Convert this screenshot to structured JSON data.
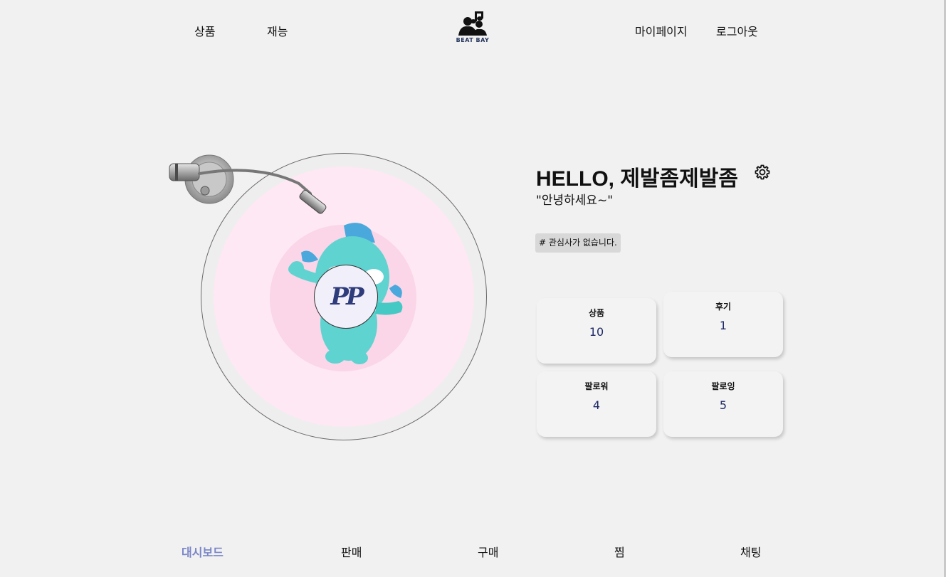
{
  "header": {
    "nav_left": [
      {
        "label": "상품"
      },
      {
        "label": "재능"
      }
    ],
    "logo_text": "BEAT BAY",
    "nav_right": [
      {
        "label": "마이페이지"
      },
      {
        "label": "로그아웃"
      }
    ]
  },
  "record": {
    "label_text": "PP"
  },
  "profile": {
    "greeting": "HELLO, 제발좀제발좀",
    "bio": "\"안녕하세요~\"",
    "interest_tag": "# 관심사가 없습니다.",
    "stats": [
      {
        "label": "상품",
        "value": "10"
      },
      {
        "label": "후기",
        "value": "1"
      },
      {
        "label": "팔로워",
        "value": "4"
      },
      {
        "label": "팔로잉",
        "value": "5"
      }
    ]
  },
  "tabs": [
    {
      "label": "대시보드",
      "active": true
    },
    {
      "label": "판매",
      "active": false
    },
    {
      "label": "구매",
      "active": false
    },
    {
      "label": "찜",
      "active": false
    },
    {
      "label": "채팅",
      "active": false
    }
  ],
  "colors": {
    "background": "#f1f1f1",
    "active_tab": "#7a86c8",
    "stat_value": "#1f2a66",
    "record_pink": "#fde8f3",
    "character": "#5fd3d0"
  },
  "icons": {
    "settings": "gear-icon",
    "logo": "beat-bay-logo"
  }
}
